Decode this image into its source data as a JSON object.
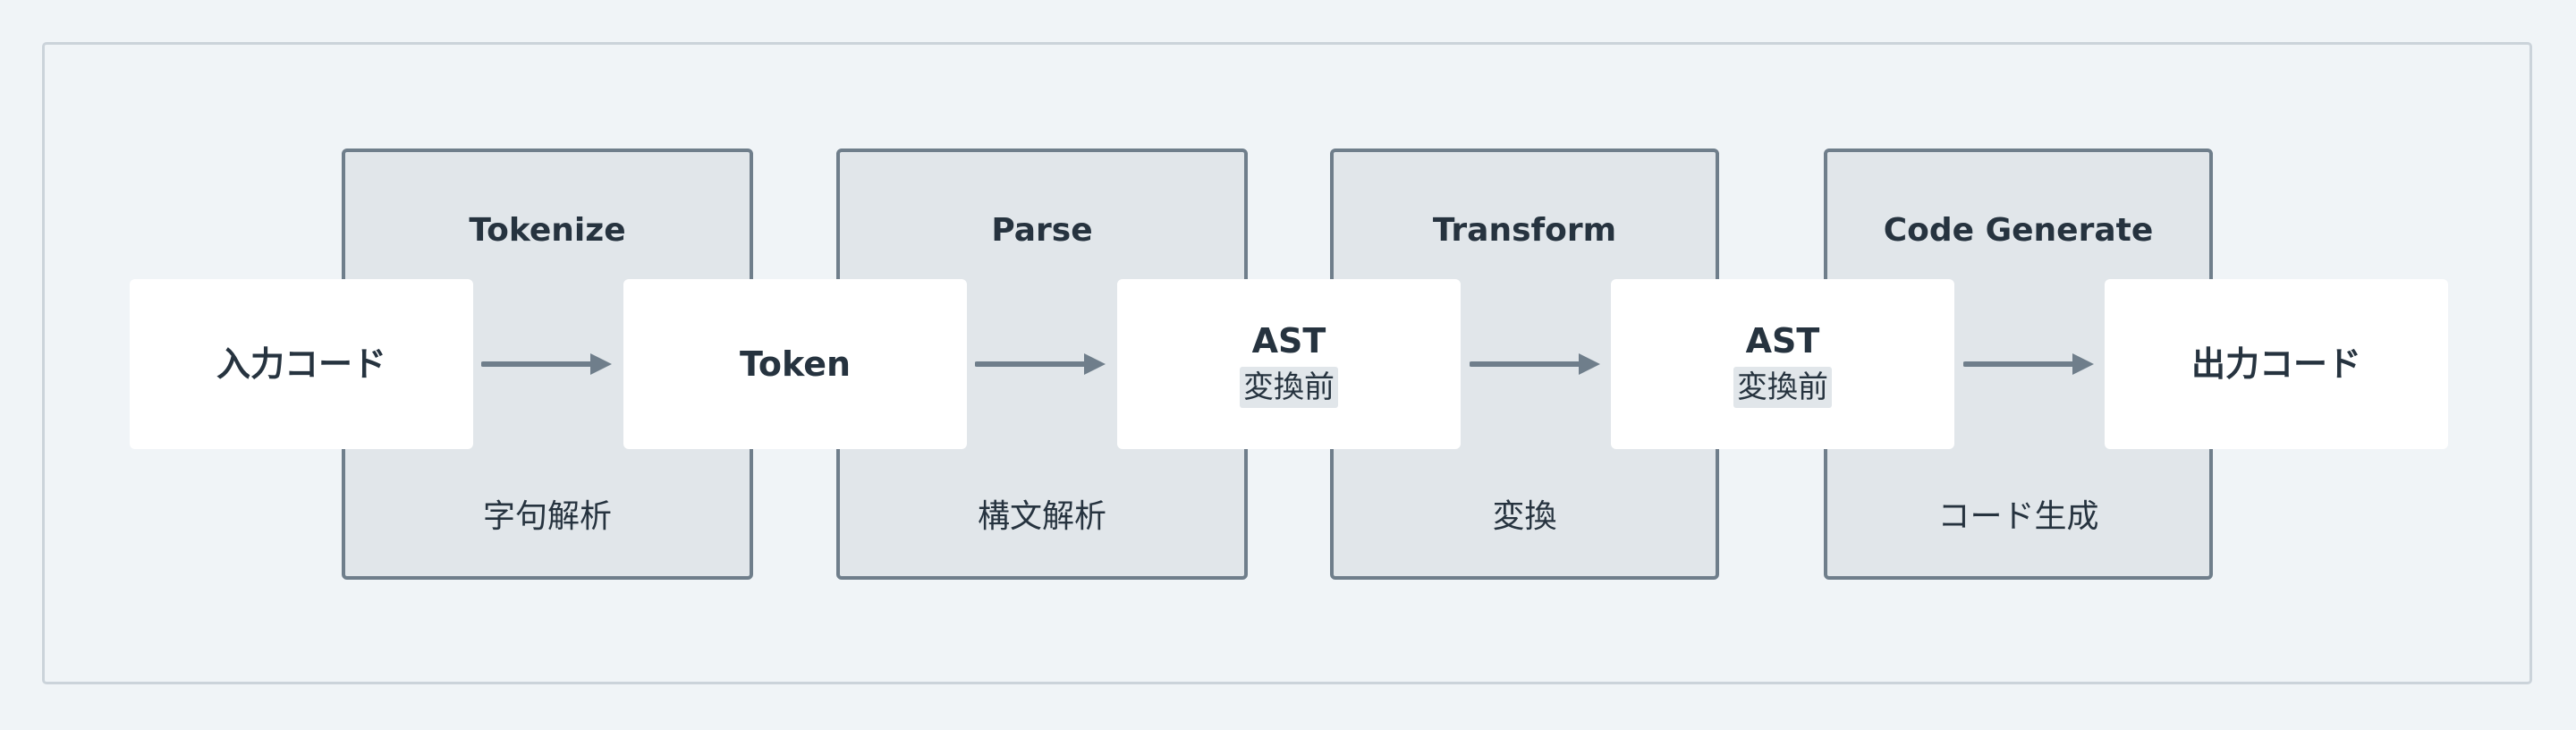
{
  "stages": [
    {
      "name": "Tokenize",
      "description": "字句解析"
    },
    {
      "name": "Parse",
      "description": "構文解析"
    },
    {
      "name": "Transform",
      "description": "変換"
    },
    {
      "name": "Code Generate",
      "description": "コード生成"
    }
  ],
  "nodes": [
    {
      "label": "入力コード"
    },
    {
      "label": "Token"
    },
    {
      "label": "AST",
      "sub": "変換前"
    },
    {
      "label": "AST",
      "sub": "変換前"
    },
    {
      "label": "出力コード"
    }
  ],
  "colors": {
    "background": "#f0f4f7",
    "frame_border": "#cbd3da",
    "stage_fill": "#e1e6ea",
    "stage_border": "#6f7e8b",
    "node_fill": "#ffffff",
    "text": "#26333f",
    "arrow": "#6f7e8b"
  }
}
